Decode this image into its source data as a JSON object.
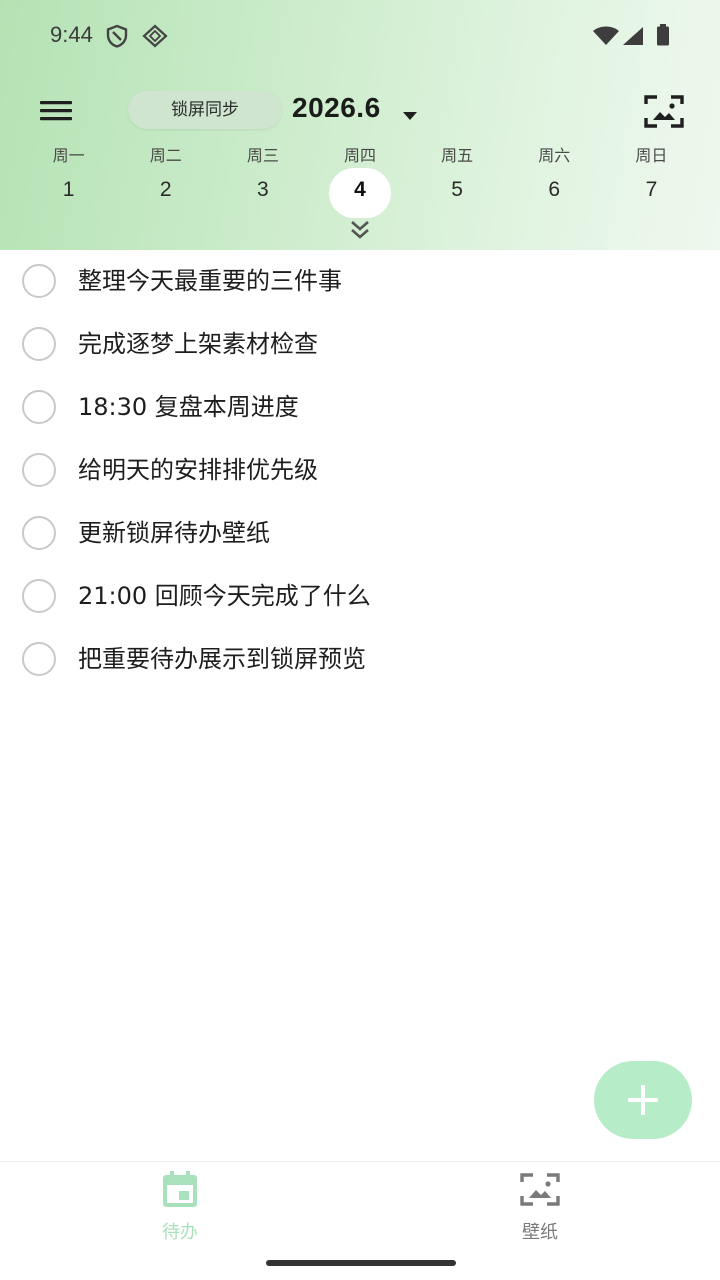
{
  "status_bar": {
    "time": "9:44",
    "icons": [
      "shield-icon",
      "vpn-diamond-icon",
      "wifi-icon",
      "cellular-signal-icon",
      "battery-icon"
    ]
  },
  "header": {
    "menu_icon": "hamburger-menu-icon",
    "chip_label": "锁屏同步",
    "month_title": "2026.6",
    "dropdown_icon": "caret-down-icon",
    "wallpaper_icon": "wallpaper-preview-icon",
    "expand_icon": "double-chevron-down-icon"
  },
  "week": {
    "days": [
      {
        "name": "周一",
        "num": "1"
      },
      {
        "name": "周二",
        "num": "2"
      },
      {
        "name": "周三",
        "num": "3"
      },
      {
        "name": "周四",
        "num": "4"
      },
      {
        "name": "周五",
        "num": "5"
      },
      {
        "name": "周六",
        "num": "6"
      },
      {
        "name": "周日",
        "num": "7"
      }
    ],
    "selected_index": 3
  },
  "todos": [
    {
      "text": "整理今天最重要的三件事",
      "done": false
    },
    {
      "text": "完成逐梦上架素材检查",
      "done": false
    },
    {
      "text": "18:30 复盘本周进度",
      "done": false
    },
    {
      "text": "给明天的安排排优先级",
      "done": false
    },
    {
      "text": "更新锁屏待办壁纸",
      "done": false
    },
    {
      "text": "21:00 回顾今天完成了什么",
      "done": false
    },
    {
      "text": "把重要待办展示到锁屏预览",
      "done": false
    }
  ],
  "fab": {
    "icon": "plus-icon"
  },
  "bottom_nav": {
    "items": [
      {
        "label": "待办",
        "icon": "calendar-icon",
        "active": true
      },
      {
        "label": "壁纸",
        "icon": "wallpaper-icon",
        "active": false
      }
    ]
  },
  "colors": {
    "accent": "#b7ecc9",
    "accent_text": "#a9e1bc",
    "header_gradient_start": "#b5e2b4",
    "header_gradient_end": "#eef8ee"
  }
}
